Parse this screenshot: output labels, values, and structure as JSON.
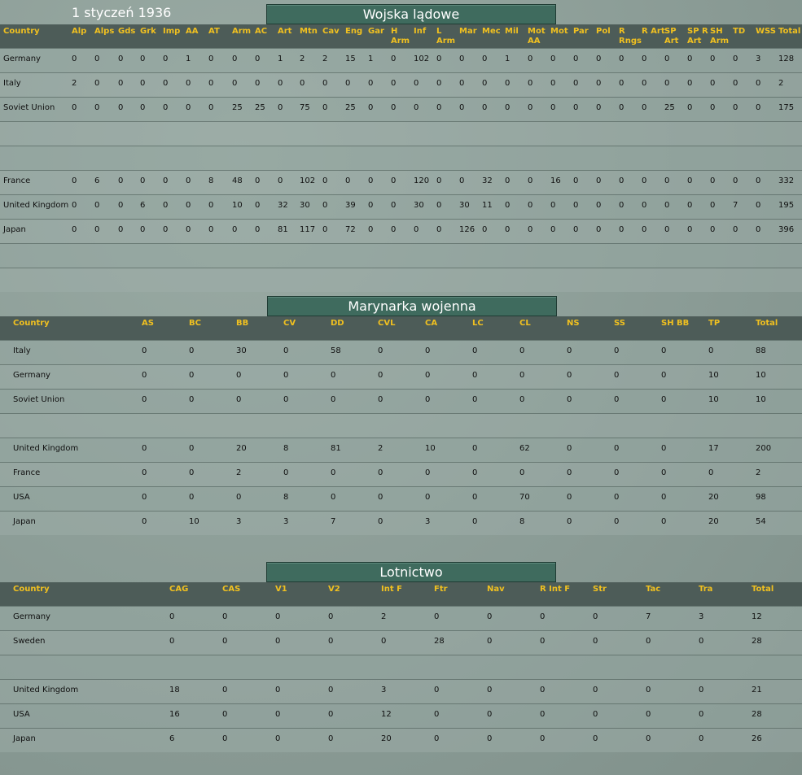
{
  "date": "1 styczeń 1936",
  "land": {
    "title": "Wojska lądowe",
    "headers": [
      "Country",
      "Alp",
      "Alps",
      "Gds",
      "Grk",
      "Imp",
      "AA",
      "AT",
      "Arm",
      "AC",
      "Art",
      "Mtn",
      "Cav",
      "Eng",
      "Gar",
      "H\nArm",
      "Inf",
      "L\nArm",
      "Mar",
      "Mec",
      "Mil",
      "Mot\nAA",
      "Mot",
      "Par",
      "Pol",
      "R\nRngs",
      "R Art",
      "SP\nArt",
      "SP R\nArt",
      "SH\nArm",
      "TD",
      "WSS",
      "Total"
    ],
    "rows": [
      [
        "Germany",
        "0",
        "0",
        "0",
        "0",
        "0",
        "1",
        "0",
        "0",
        "0",
        "1",
        "2",
        "2",
        "15",
        "1",
        "0",
        "102",
        "0",
        "0",
        "0",
        "1",
        "0",
        "0",
        "0",
        "0",
        "0",
        "0",
        "0",
        "0",
        "0",
        "0",
        "3",
        "128"
      ],
      [
        "Italy",
        "2",
        "0",
        "0",
        "0",
        "0",
        "0",
        "0",
        "0",
        "0",
        "0",
        "0",
        "0",
        "0",
        "0",
        "0",
        "0",
        "0",
        "0",
        "0",
        "0",
        "0",
        "0",
        "0",
        "0",
        "0",
        "0",
        "0",
        "0",
        "0",
        "0",
        "0",
        "2"
      ],
      [
        "Soviet Union",
        "0",
        "0",
        "0",
        "0",
        "0",
        "0",
        "0",
        "25",
        "25",
        "0",
        "75",
        "0",
        "25",
        "0",
        "0",
        "0",
        "0",
        "0",
        "0",
        "0",
        "0",
        "0",
        "0",
        "0",
        "0",
        "0",
        "25",
        "0",
        "0",
        "0",
        "0",
        "175"
      ],
      [],
      [],
      [
        "France",
        "0",
        "6",
        "0",
        "0",
        "0",
        "0",
        "8",
        "48",
        "0",
        "0",
        "102",
        "0",
        "0",
        "0",
        "0",
        "120",
        "0",
        "0",
        "32",
        "0",
        "0",
        "16",
        "0",
        "0",
        "0",
        "0",
        "0",
        "0",
        "0",
        "0",
        "0",
        "332"
      ],
      [
        "United Kingdom",
        "0",
        "0",
        "0",
        "6",
        "0",
        "0",
        "0",
        "10",
        "0",
        "32",
        "30",
        "0",
        "39",
        "0",
        "0",
        "30",
        "0",
        "30",
        "11",
        "0",
        "0",
        "0",
        "0",
        "0",
        "0",
        "0",
        "0",
        "0",
        "0",
        "7",
        "0",
        "195"
      ],
      [
        "Japan",
        "0",
        "0",
        "0",
        "0",
        "0",
        "0",
        "0",
        "0",
        "0",
        "81",
        "117",
        "0",
        "72",
        "0",
        "0",
        "0",
        "0",
        "126",
        "0",
        "0",
        "0",
        "0",
        "0",
        "0",
        "0",
        "0",
        "0",
        "0",
        "0",
        "0",
        "0",
        "396"
      ],
      [],
      []
    ]
  },
  "naval": {
    "title": "Marynarka wojenna",
    "headers": [
      "Country",
      "AS",
      "BC",
      "BB",
      "CV",
      "DD",
      "CVL",
      "CA",
      "LC",
      "CL",
      "NS",
      "SS",
      "SH BB",
      "TP",
      "Total"
    ],
    "rows": [
      [
        "Italy",
        "0",
        "0",
        "30",
        "0",
        "58",
        "0",
        "0",
        "0",
        "0",
        "0",
        "0",
        "0",
        "0",
        "88"
      ],
      [
        "Germany",
        "0",
        "0",
        "0",
        "0",
        "0",
        "0",
        "0",
        "0",
        "0",
        "0",
        "0",
        "0",
        "10",
        "10"
      ],
      [
        "Soviet Union",
        "0",
        "0",
        "0",
        "0",
        "0",
        "0",
        "0",
        "0",
        "0",
        "0",
        "0",
        "0",
        "10",
        "10"
      ],
      [],
      [
        "United Kingdom",
        "0",
        "0",
        "20",
        "8",
        "81",
        "2",
        "10",
        "0",
        "62",
        "0",
        "0",
        "0",
        "17",
        "200"
      ],
      [
        "France",
        "0",
        "0",
        "2",
        "0",
        "0",
        "0",
        "0",
        "0",
        "0",
        "0",
        "0",
        "0",
        "0",
        "2"
      ],
      [
        "USA",
        "0",
        "0",
        "0",
        "8",
        "0",
        "0",
        "0",
        "0",
        "70",
        "0",
        "0",
        "0",
        "20",
        "98"
      ],
      [
        "Japan",
        "0",
        "10",
        "3",
        "3",
        "7",
        "0",
        "3",
        "0",
        "8",
        "0",
        "0",
        "0",
        "20",
        "54"
      ]
    ]
  },
  "air": {
    "title": "Lotnictwo",
    "headers": [
      "Country",
      "CAG",
      "CAS",
      "V1",
      "V2",
      "Int F",
      "Ftr",
      "Nav",
      "R Int F",
      "Str",
      "Tac",
      "Tra",
      "Total"
    ],
    "rows": [
      [
        "Germany",
        "0",
        "0",
        "0",
        "0",
        "2",
        "0",
        "0",
        "0",
        "0",
        "7",
        "3",
        "12"
      ],
      [
        "Sweden",
        "0",
        "0",
        "0",
        "0",
        "0",
        "28",
        "0",
        "0",
        "0",
        "0",
        "0",
        "28"
      ],
      [],
      [
        "United Kingdom",
        "18",
        "0",
        "0",
        "0",
        "3",
        "0",
        "0",
        "0",
        "0",
        "0",
        "0",
        "21"
      ],
      [
        "USA",
        "16",
        "0",
        "0",
        "0",
        "12",
        "0",
        "0",
        "0",
        "0",
        "0",
        "0",
        "28"
      ],
      [
        "Japan",
        "6",
        "0",
        "0",
        "0",
        "20",
        "0",
        "0",
        "0",
        "0",
        "0",
        "0",
        "26"
      ]
    ]
  }
}
